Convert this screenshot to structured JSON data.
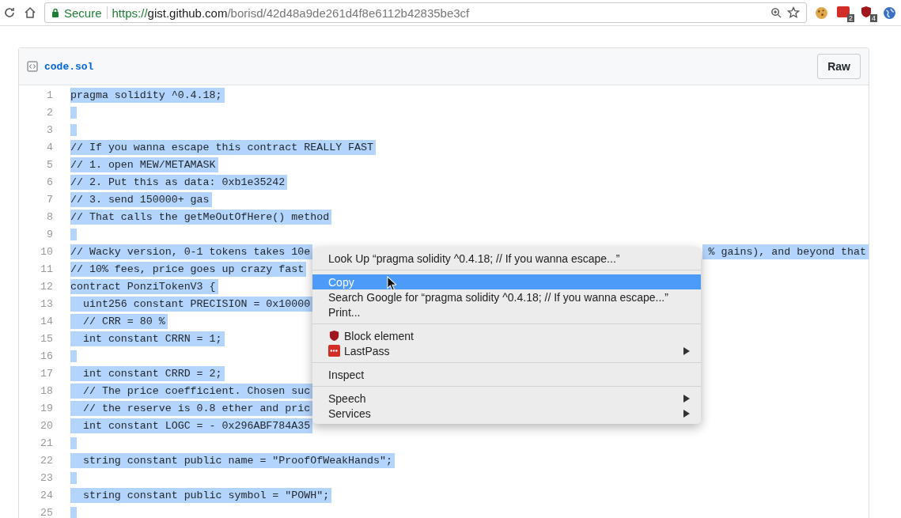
{
  "browser": {
    "secure_label": "Secure",
    "url_scheme": "https://",
    "url_host": "gist.github.com",
    "url_path": "/borisd/42d48a9de261d4f8e6112b42835be3cf",
    "extensions": [
      {
        "kind": "cookie"
      },
      {
        "kind": "lastpass",
        "badge": "2"
      },
      {
        "kind": "ublock",
        "badge": "4"
      },
      {
        "kind": "globe"
      }
    ]
  },
  "file": {
    "name": "code.sol",
    "raw_button": "Raw"
  },
  "code_lines": [
    {
      "number": "1",
      "text": "pragma solidity ^0.4.18;",
      "selected": true
    },
    {
      "number": "2",
      "selected": true
    },
    {
      "number": "3",
      "selected": true
    },
    {
      "number": "4",
      "text": "// If you wanna escape this contract REALLY FAST",
      "selected": true
    },
    {
      "number": "5",
      "text": "// 1. open MEW/METAMASK",
      "selected": true
    },
    {
      "number": "6",
      "text": "// 2. Put this as data: 0xb1e35242",
      "selected": true
    },
    {
      "number": "7",
      "text": "// 3. send 150000+ gas",
      "selected": true
    },
    {
      "number": "8",
      "text": "// That calls the getMeOutOfHere() method",
      "selected": true
    },
    {
      "number": "9",
      "selected": true
    },
    {
      "number": "10",
      "text": "// Wacky version, 0-1 tokens takes 10e",
      "text_after_menu": "% gains), and beyond that",
      "selected": true
    },
    {
      "number": "11",
      "text": "// 10% fees, price goes up crazy fast",
      "selected": true
    },
    {
      "number": "12",
      "text": "contract PonziTokenV3 {",
      "selected": true
    },
    {
      "number": "13",
      "text": "  uint256 constant PRECISION = 0x10000",
      "selected": true
    },
    {
      "number": "14",
      "text": "  // CRR = 80 %",
      "selected": true
    },
    {
      "number": "15",
      "text": "  int constant CRRN = 1;",
      "selected": true
    },
    {
      "number": "16",
      "selected": true
    },
    {
      "number": "17",
      "text": "  int constant CRRD = 2;",
      "selected": true
    },
    {
      "number": "18",
      "text": "  // The price coefficient. Chosen suc",
      "selected": true
    },
    {
      "number": "19",
      "text": "  // the reserve is 0.8 ether and pric",
      "selected": true
    },
    {
      "number": "20",
      "text": "  int constant LOGC = - 0x296ABF784A35",
      "selected": true
    },
    {
      "number": "21",
      "selected": true
    },
    {
      "number": "22",
      "text": "  string constant public name = \"ProofOfWeakHands\";",
      "selected": true
    },
    {
      "number": "23",
      "selected": true
    },
    {
      "number": "24",
      "text": "  string constant public symbol = \"POWH\";",
      "selected": true
    },
    {
      "number": "25",
      "selected": true
    }
  ],
  "context_menu": {
    "items": [
      {
        "kind": "item",
        "label": "Look Up “pragma solidity ^0.4.18;   // If you wanna escape...”",
        "selected": false,
        "submenu": false
      },
      {
        "kind": "separator"
      },
      {
        "kind": "item",
        "label": "Copy",
        "selected": true,
        "submenu": false
      },
      {
        "kind": "item",
        "label": "Search Google for “pragma solidity ^0.4.18;   // If you wanna escape...”",
        "selected": false,
        "submenu": false
      },
      {
        "kind": "item",
        "label": "Print...",
        "selected": false,
        "submenu": false
      },
      {
        "kind": "separator"
      },
      {
        "kind": "blocker",
        "label": "Block element",
        "selected": false,
        "submenu": false
      },
      {
        "kind": "password_manager",
        "label": "LastPass",
        "selected": false,
        "submenu": true
      },
      {
        "kind": "separator"
      },
      {
        "kind": "item",
        "label": "Inspect",
        "selected": false,
        "submenu": false
      },
      {
        "kind": "separator"
      },
      {
        "kind": "item",
        "label": "Speech",
        "selected": false,
        "submenu": true
      },
      {
        "kind": "item",
        "label": "Services",
        "selected": false,
        "submenu": true
      }
    ]
  }
}
